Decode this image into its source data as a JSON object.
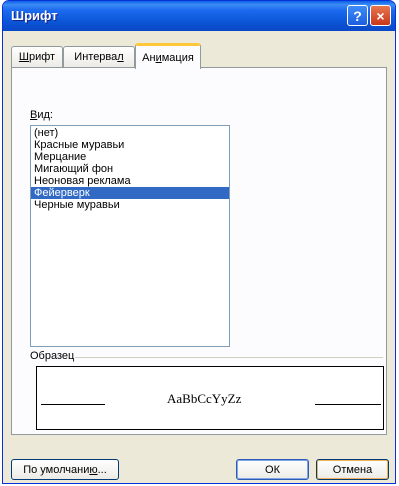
{
  "window": {
    "title": "Шрифт"
  },
  "titlebar_buttons": {
    "help": "?",
    "close": "×"
  },
  "tabs": [
    {
      "label": "Шрифт",
      "mnemonic": "Ш",
      "rest": "рифт"
    },
    {
      "label": "Интервал",
      "before": "Интерва",
      "mnemonic": "л"
    },
    {
      "label": "Анимация",
      "before": "Ан",
      "mnemonic": "и",
      "after": "мация",
      "active": true
    }
  ],
  "animation": {
    "label": "Вид:",
    "label_mnemonic": "В",
    "label_rest": "ид:",
    "options": [
      "(нет)",
      "Красные муравьи",
      "Мерцание",
      "Мигающий фон",
      "Неоновая реклама",
      "Фейерверк",
      "Черные муравьи"
    ],
    "selected": "Фейерверк"
  },
  "preview": {
    "group_label": "Образец",
    "sample_text": "AaBbCcYyZz"
  },
  "buttons": {
    "default_label": "По умолчанию...",
    "default_before": "По умолчани",
    "default_mnemonic": "ю",
    "default_after": "...",
    "ok_label": "ОК",
    "cancel_label": "Отмена"
  },
  "colors": {
    "titlebar": "#0A5FE8",
    "selection": "#316AC5",
    "active_tab_accent": "#FFC83C",
    "close_button": "#C8371A"
  }
}
